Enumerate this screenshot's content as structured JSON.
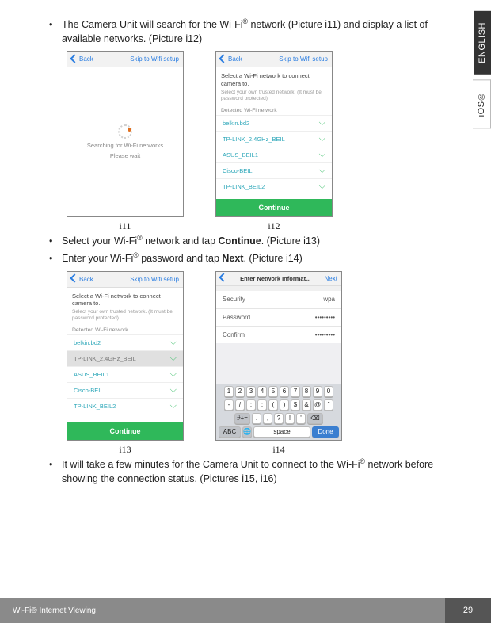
{
  "side_tabs": {
    "english": "ENGLISH",
    "ios": "iOS®"
  },
  "bullets": {
    "b1_a": "The Camera Unit will search for the Wi-Fi",
    "b1_b": " network (Picture i11) and display a list of available networks. (Picture i12)",
    "b2_a": "Select your Wi-Fi",
    "b2_b": " network and tap ",
    "b2_c": "Continue",
    "b2_d": ". (Picture i13)",
    "b3_a": "Enter your Wi-Fi",
    "b3_b": " password and tap ",
    "b3_c": "Next",
    "b3_d": ". (Picture i14)",
    "b4_a": "It will take a few minutes for the Camera Unit to connect to the Wi-Fi",
    "b4_b": " network before showing the connection status. (Pictures i15, i16)"
  },
  "reg": "®",
  "fig_labels": {
    "i11": "i11",
    "i12": "i12",
    "i13": "i13",
    "i14": "i14"
  },
  "phone_common": {
    "back": "Back",
    "skip": "Skip to Wifi setup",
    "select_head": "Select a Wi-Fi network to connect camera to.",
    "select_sub": "Select your own trusted network. (It must be password protected)",
    "detected": "Detected Wi-Fi network",
    "continue": "Continue"
  },
  "i11": {
    "searching": "Searching for Wi-Fi networks",
    "wait": "Please wait"
  },
  "networks": [
    "belkin.bd2",
    "TP-LINK_2.4GHz_BEIL",
    "ASUS_BEIL1",
    "Cisco-BEIL",
    "TP-LINK_BEIL2"
  ],
  "i14": {
    "title": "Enter Network Informat...",
    "next": "Next",
    "security_lbl": "Security",
    "security_val": "wpa",
    "password_lbl": "Password",
    "password_val": "•••••••••",
    "confirm_lbl": "Confirm",
    "confirm_val": "•••••••••",
    "row_num": [
      "1",
      "2",
      "3",
      "4",
      "5",
      "6",
      "7",
      "8",
      "9",
      "0"
    ],
    "row_sym1": [
      "-",
      "/",
      ":",
      ";",
      "(",
      ")",
      "$",
      "&",
      "@",
      "\""
    ],
    "row_sym2": [
      ".",
      ",",
      "?",
      "!",
      "'"
    ],
    "shift_key": "#+=",
    "backspace": "⌫",
    "abc": "ABC",
    "globe": "🌐",
    "space": "space",
    "done": "Done"
  },
  "footer": {
    "section": "Wi-Fi® Internet Viewing",
    "page": "29"
  }
}
